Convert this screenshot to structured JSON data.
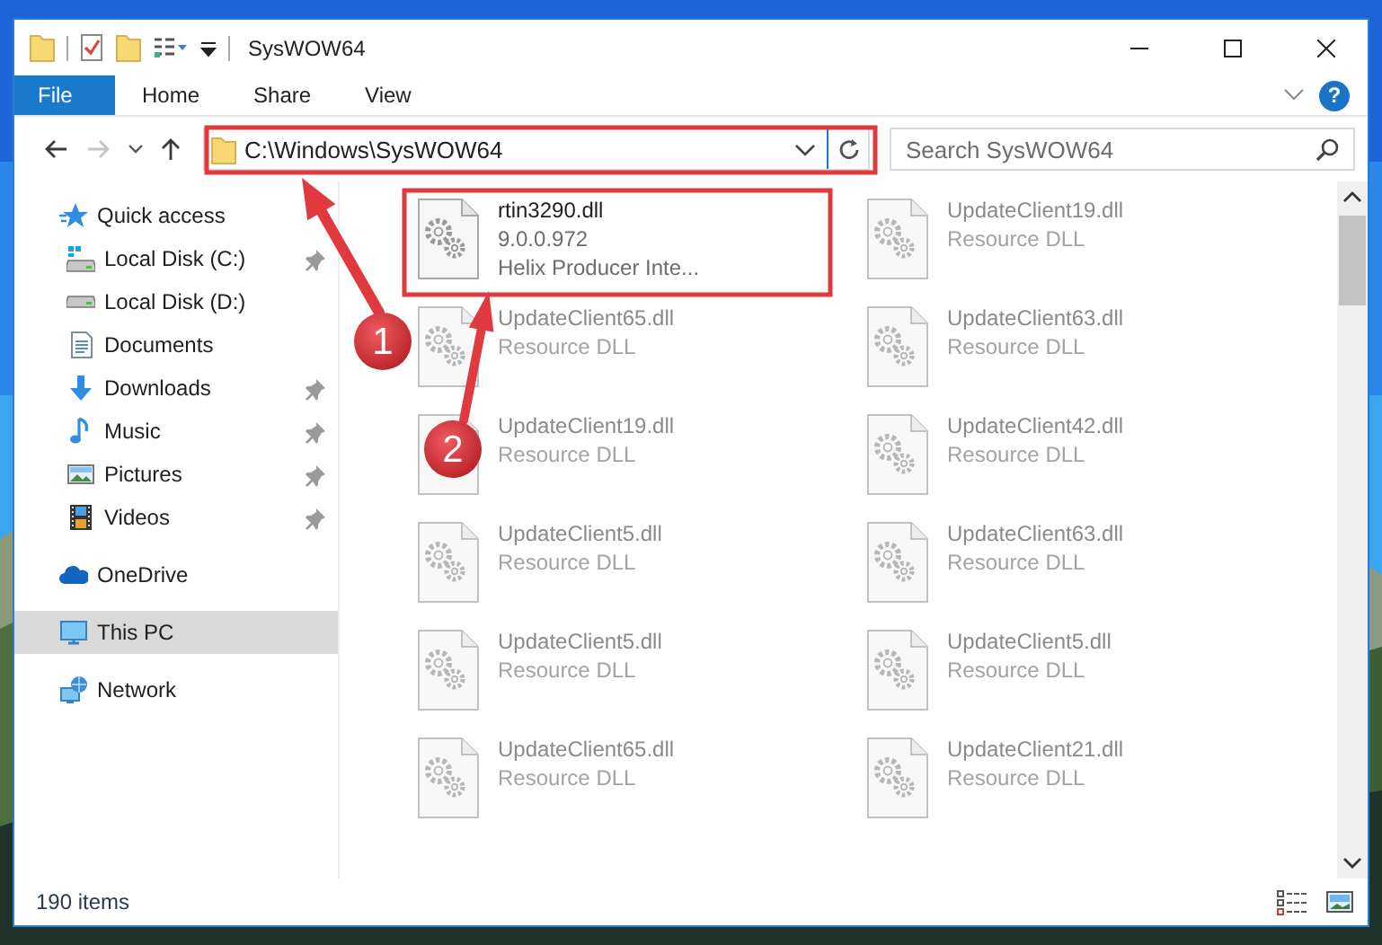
{
  "window": {
    "title": "SysWOW64"
  },
  "ribbon_tabs": [
    {
      "label": "File",
      "kind": "file"
    },
    {
      "label": "Home",
      "kind": "tab"
    },
    {
      "label": "Share",
      "kind": "tab"
    },
    {
      "label": "View",
      "kind": "tab"
    }
  ],
  "help_button": "?",
  "navigation": {
    "back_disabled": false,
    "forward_disabled": true
  },
  "address_bar": {
    "path": "C:\\Windows\\SysWOW64"
  },
  "search": {
    "placeholder": "Search SysWOW64"
  },
  "sidebar": {
    "items": [
      {
        "label": "Quick access",
        "kind": "star",
        "pinned": false,
        "selected": false,
        "children": [
          {
            "label": "Local Disk (C:)",
            "kind": "drive-win",
            "pinned": true,
            "selected": false
          },
          {
            "label": "Local Disk (D:)",
            "kind": "drive",
            "pinned": false,
            "selected": false
          },
          {
            "label": "Documents",
            "kind": "document",
            "pinned": false,
            "selected": false
          },
          {
            "label": "Downloads",
            "kind": "download",
            "pinned": true,
            "selected": false
          },
          {
            "label": "Music",
            "kind": "music",
            "pinned": true,
            "selected": false
          },
          {
            "label": "Pictures",
            "kind": "picture",
            "pinned": true,
            "selected": false
          },
          {
            "label": "Videos",
            "kind": "video",
            "pinned": true,
            "selected": false
          }
        ]
      },
      {
        "label": "OneDrive",
        "kind": "cloud",
        "pinned": false,
        "selected": false
      },
      {
        "label": "This PC",
        "kind": "pc",
        "pinned": false,
        "selected": true
      },
      {
        "label": "Network",
        "kind": "network",
        "pinned": false,
        "selected": false
      }
    ]
  },
  "files": [
    {
      "name": "rtin3290.dll",
      "lines": [
        "9.0.0.972",
        "Helix Producer Inte..."
      ],
      "blurred": false
    },
    {
      "name": "UpdateClient19.dll",
      "lines": [
        "Resource DLL"
      ],
      "blurred": true
    },
    {
      "name": "UpdateClient65.dll",
      "lines": [
        "Resource DLL"
      ],
      "blurred": true
    },
    {
      "name": "UpdateClient63.dll",
      "lines": [
        "Resource DLL"
      ],
      "blurred": true
    },
    {
      "name": "UpdateClient19.dll",
      "lines": [
        "Resource DLL"
      ],
      "blurred": true
    },
    {
      "name": "UpdateClient42.dll",
      "lines": [
        "Resource DLL"
      ],
      "blurred": true
    },
    {
      "name": "UpdateClient5.dll",
      "lines": [
        "Resource DLL"
      ],
      "blurred": true
    },
    {
      "name": "UpdateClient63.dll",
      "lines": [
        "Resource DLL"
      ],
      "blurred": true
    },
    {
      "name": "UpdateClient5.dll",
      "lines": [
        "Resource DLL"
      ],
      "blurred": true
    },
    {
      "name": "UpdateClient5.dll",
      "lines": [
        "Resource DLL"
      ],
      "blurred": true
    },
    {
      "name": "UpdateClient65.dll",
      "lines": [
        "Resource DLL"
      ],
      "blurred": true
    },
    {
      "name": "UpdateClient21.dll",
      "lines": [
        "Resource DLL"
      ],
      "blurred": true
    }
  ],
  "status_bar": {
    "item_count": "190 items"
  },
  "callouts": [
    {
      "number": "1"
    },
    {
      "number": "2"
    }
  ]
}
